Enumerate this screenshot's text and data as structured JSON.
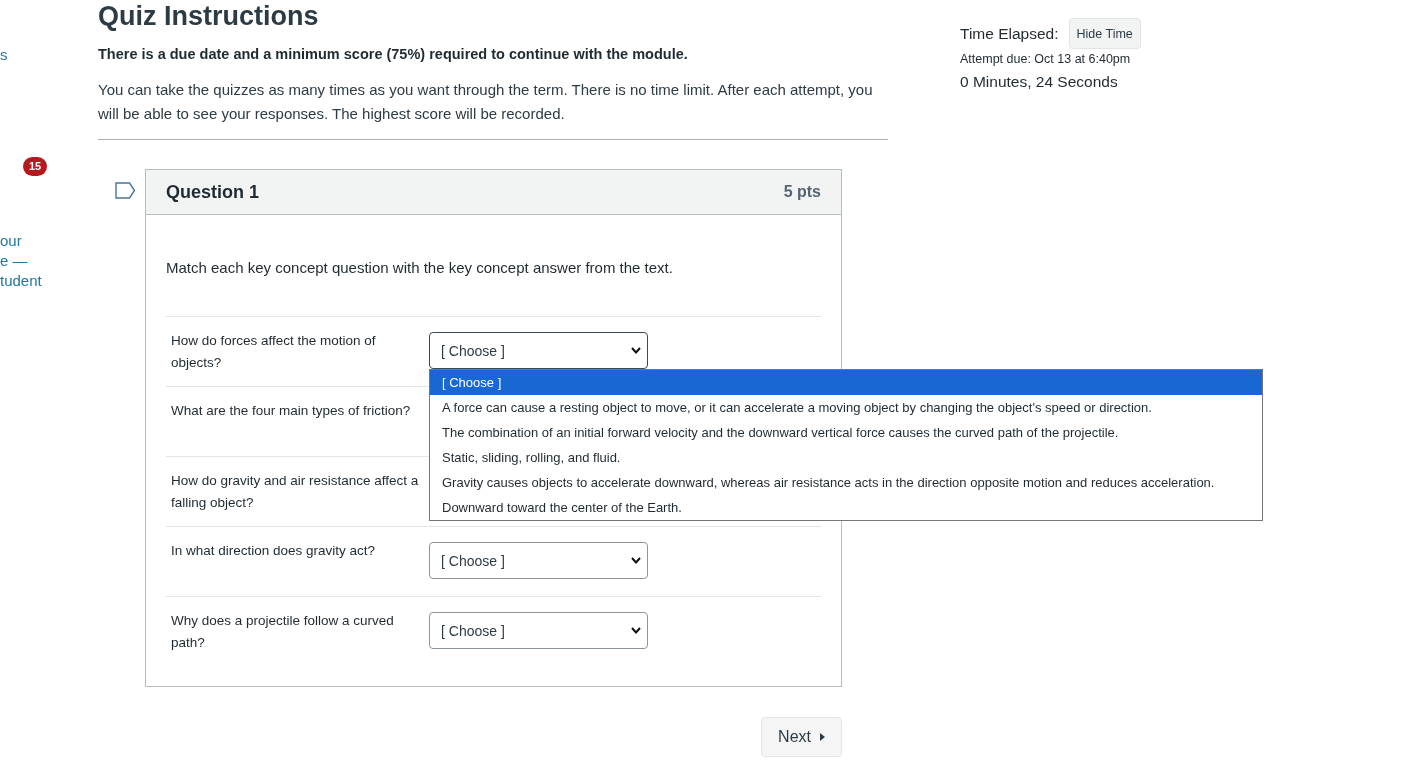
{
  "sidebar": {
    "items": [
      {
        "kind": "link",
        "lines": [
          "s"
        ]
      },
      {
        "kind": "badge",
        "text": "15"
      },
      {
        "kind": "link",
        "lines": [
          "our",
          "e —",
          "tudent"
        ]
      }
    ]
  },
  "quiz": {
    "title": "Quiz Instructions",
    "requirement": "There is a due date and a minimum score (75%) required to continue with the module.",
    "description": "You can take the quizzes as many times as you want through the term. There is no time limit. After each attempt, you will be able to see your responses. The highest score will be recorded."
  },
  "timer": {
    "label": "Time Elapsed:",
    "hide_button": "Hide Time",
    "attempt_due": "Attempt due: Oct 13 at 6:40pm",
    "elapsed": "0 Minutes, 24 Seconds"
  },
  "question": {
    "flagged": false,
    "title": "Question 1",
    "points": "5 pts",
    "prompt": "Match each key concept question with the key concept answer from the text.",
    "matches": [
      {
        "question": "How do forces affect the motion of objects?",
        "answer": "[ Choose ]",
        "expanded": true,
        "options": [
          {
            "label": "[ Choose ]",
            "selected": true
          },
          {
            "label": "A force can cause a resting object to move, or it can accelerate a moving object by changing the object's speed or direction.",
            "selected": false
          },
          {
            "label": "The combination of an initial forward velocity and the downward vertical force causes the curved path of the projectile.",
            "selected": false
          },
          {
            "label": "Static, sliding, rolling, and fluid.",
            "selected": false
          },
          {
            "label": "Gravity causes objects to accelerate downward, whereas air resistance acts in the direction opposite motion and reduces acceleration.",
            "selected": false
          },
          {
            "label": "Downward toward the center of the Earth.",
            "selected": false
          }
        ]
      },
      {
        "question": "What are the four main types of friction?"
      },
      {
        "question": "How do gravity and air resistance affect a falling object?"
      },
      {
        "question": "In what direction does gravity act?",
        "answer": "[ Choose ]",
        "expanded": false
      },
      {
        "question": "Why does a projectile follow a curved path?",
        "answer": "[ Choose ]",
        "expanded": false
      }
    ]
  },
  "footer": {
    "next_button": "Next"
  }
}
